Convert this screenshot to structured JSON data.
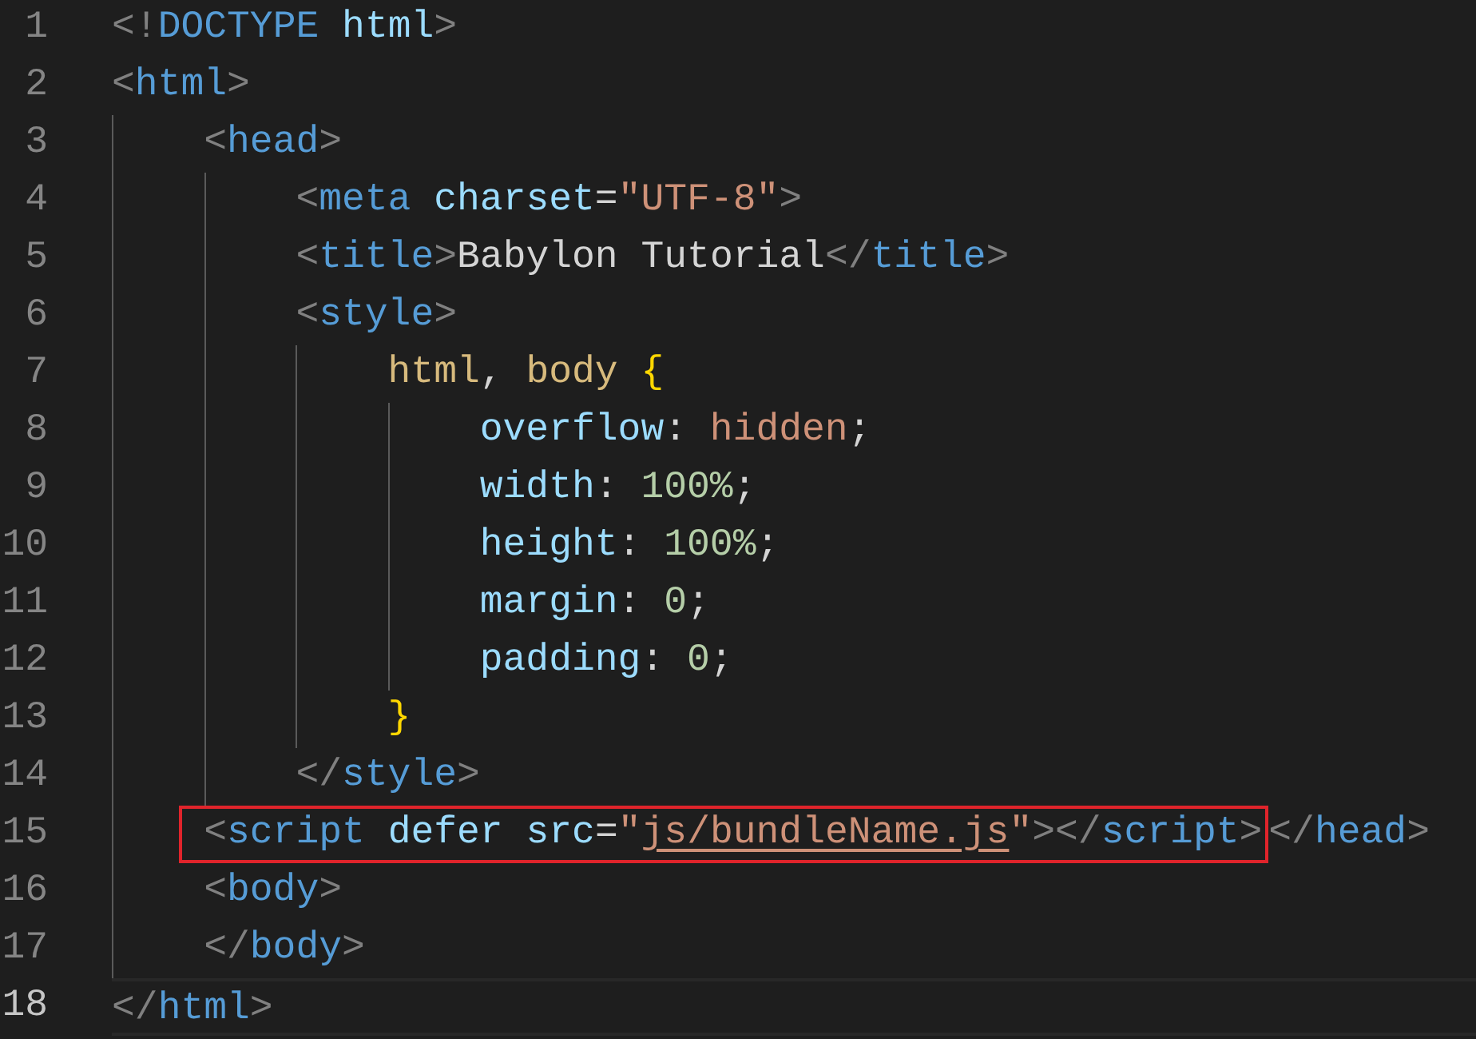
{
  "editor": {
    "lines": [
      {
        "number": "1",
        "current": false,
        "segments": [
          {
            "boxed": false,
            "tokens": [
              {
                "kind": "punct",
                "text": "<!"
              },
              {
                "kind": "tag",
                "text": "DOCTYPE"
              },
              {
                "kind": "attr",
                "text": " html"
              },
              {
                "kind": "punct",
                "text": ">"
              }
            ]
          }
        ]
      },
      {
        "number": "2",
        "current": false,
        "segments": [
          {
            "boxed": false,
            "tokens": [
              {
                "kind": "punct",
                "text": "<"
              },
              {
                "kind": "tag",
                "text": "html"
              },
              {
                "kind": "punct",
                "text": ">"
              }
            ]
          }
        ],
        "children": [
          {
            "number": "3",
            "current": false,
            "segments": [
              {
                "boxed": false,
                "tokens": [
                  {
                    "kind": "punct",
                    "text": "<"
                  },
                  {
                    "kind": "tag",
                    "text": "head"
                  },
                  {
                    "kind": "punct",
                    "text": ">"
                  }
                ]
              }
            ],
            "children": [
              {
                "number": "4",
                "current": false,
                "segments": [
                  {
                    "boxed": false,
                    "tokens": [
                      {
                        "kind": "punct",
                        "text": "<"
                      },
                      {
                        "kind": "tag",
                        "text": "meta"
                      },
                      {
                        "kind": "attr",
                        "text": " charset"
                      },
                      {
                        "kind": "text",
                        "text": "="
                      },
                      {
                        "kind": "string",
                        "text": "\"UTF-8\""
                      },
                      {
                        "kind": "punct",
                        "text": ">"
                      }
                    ]
                  }
                ]
              },
              {
                "number": "5",
                "current": false,
                "segments": [
                  {
                    "boxed": false,
                    "tokens": [
                      {
                        "kind": "punct",
                        "text": "<"
                      },
                      {
                        "kind": "tag",
                        "text": "title"
                      },
                      {
                        "kind": "punct",
                        "text": ">"
                      },
                      {
                        "kind": "text",
                        "text": "Babylon Tutorial"
                      },
                      {
                        "kind": "punct",
                        "text": "</"
                      },
                      {
                        "kind": "tag",
                        "text": "title"
                      },
                      {
                        "kind": "punct",
                        "text": ">"
                      }
                    ]
                  }
                ]
              },
              {
                "number": "6",
                "current": false,
                "segments": [
                  {
                    "boxed": false,
                    "tokens": [
                      {
                        "kind": "punct",
                        "text": "<"
                      },
                      {
                        "kind": "tag",
                        "text": "style"
                      },
                      {
                        "kind": "punct",
                        "text": ">"
                      }
                    ]
                  }
                ],
                "children": [
                  {
                    "number": "7",
                    "current": false,
                    "segments": [
                      {
                        "boxed": false,
                        "tokens": [
                          {
                            "kind": "selector",
                            "text": "html"
                          },
                          {
                            "kind": "text",
                            "text": ", "
                          },
                          {
                            "kind": "selector",
                            "text": "body"
                          },
                          {
                            "kind": "brace",
                            "text": " {"
                          }
                        ]
                      }
                    ],
                    "children": [
                      {
                        "number": "8",
                        "current": false,
                        "segments": [
                          {
                            "boxed": false,
                            "tokens": [
                              {
                                "kind": "attr",
                                "text": "overflow"
                              },
                              {
                                "kind": "text",
                                "text": ": "
                              },
                              {
                                "kind": "string",
                                "text": "hidden"
                              },
                              {
                                "kind": "text",
                                "text": ";"
                              }
                            ]
                          }
                        ]
                      },
                      {
                        "number": "9",
                        "current": false,
                        "segments": [
                          {
                            "boxed": false,
                            "tokens": [
                              {
                                "kind": "attr",
                                "text": "width"
                              },
                              {
                                "kind": "text",
                                "text": ": "
                              },
                              {
                                "kind": "number",
                                "text": "100%"
                              },
                              {
                                "kind": "text",
                                "text": ";"
                              }
                            ]
                          }
                        ]
                      },
                      {
                        "number": "10",
                        "current": false,
                        "segments": [
                          {
                            "boxed": false,
                            "tokens": [
                              {
                                "kind": "attr",
                                "text": "height"
                              },
                              {
                                "kind": "text",
                                "text": ": "
                              },
                              {
                                "kind": "number",
                                "text": "100%"
                              },
                              {
                                "kind": "text",
                                "text": ";"
                              }
                            ]
                          }
                        ]
                      },
                      {
                        "number": "11",
                        "current": false,
                        "segments": [
                          {
                            "boxed": false,
                            "tokens": [
                              {
                                "kind": "attr",
                                "text": "margin"
                              },
                              {
                                "kind": "text",
                                "text": ": "
                              },
                              {
                                "kind": "number",
                                "text": "0"
                              },
                              {
                                "kind": "text",
                                "text": ";"
                              }
                            ]
                          }
                        ]
                      },
                      {
                        "number": "12",
                        "current": false,
                        "segments": [
                          {
                            "boxed": false,
                            "tokens": [
                              {
                                "kind": "attr",
                                "text": "padding"
                              },
                              {
                                "kind": "text",
                                "text": ": "
                              },
                              {
                                "kind": "number",
                                "text": "0"
                              },
                              {
                                "kind": "text",
                                "text": ";"
                              }
                            ]
                          }
                        ]
                      }
                    ]
                  },
                  {
                    "number": "13",
                    "current": false,
                    "segments": [
                      {
                        "boxed": false,
                        "tokens": [
                          {
                            "kind": "brace",
                            "text": "}"
                          }
                        ]
                      }
                    ]
                  }
                ]
              },
              {
                "number": "14",
                "current": false,
                "segments": [
                  {
                    "boxed": false,
                    "tokens": [
                      {
                        "kind": "punct",
                        "text": "</"
                      },
                      {
                        "kind": "tag",
                        "text": "style"
                      },
                      {
                        "kind": "punct",
                        "text": ">"
                      }
                    ]
                  }
                ]
              }
            ]
          },
          {
            "number": "15",
            "current": false,
            "segments": [
              {
                "boxed": true,
                "tokens": [
                  {
                    "kind": "punct",
                    "text": "<"
                  },
                  {
                    "kind": "tag",
                    "text": "script"
                  },
                  {
                    "kind": "attr",
                    "text": " defer"
                  },
                  {
                    "kind": "attr",
                    "text": " src"
                  },
                  {
                    "kind": "text",
                    "text": "="
                  },
                  {
                    "kind": "string",
                    "text": "\""
                  },
                  {
                    "kind": "link",
                    "text": "js/bundleName.js"
                  },
                  {
                    "kind": "string",
                    "text": "\""
                  },
                  {
                    "kind": "punct",
                    "text": "></"
                  },
                  {
                    "kind": "tag",
                    "text": "script"
                  },
                  {
                    "kind": "punct",
                    "text": ">"
                  }
                ]
              },
              {
                "boxed": false,
                "tokens": [
                  {
                    "kind": "punct",
                    "text": "</"
                  },
                  {
                    "kind": "tag",
                    "text": "head"
                  },
                  {
                    "kind": "punct",
                    "text": ">"
                  }
                ]
              }
            ]
          },
          {
            "number": "16",
            "current": false,
            "segments": [
              {
                "boxed": false,
                "tokens": [
                  {
                    "kind": "punct",
                    "text": "<"
                  },
                  {
                    "kind": "tag",
                    "text": "body"
                  },
                  {
                    "kind": "punct",
                    "text": ">"
                  }
                ]
              }
            ]
          },
          {
            "number": "17",
            "current": false,
            "segments": [
              {
                "boxed": false,
                "tokens": [
                  {
                    "kind": "punct",
                    "text": "</"
                  },
                  {
                    "kind": "tag",
                    "text": "body"
                  },
                  {
                    "kind": "punct",
                    "text": ">"
                  }
                ]
              }
            ]
          }
        ]
      },
      {
        "number": "18",
        "current": true,
        "segments": [
          {
            "boxed": false,
            "tokens": [
              {
                "kind": "punct",
                "text": "</"
              },
              {
                "kind": "tag",
                "text": "html"
              },
              {
                "kind": "punct",
                "text": ">"
              }
            ]
          }
        ]
      }
    ]
  }
}
